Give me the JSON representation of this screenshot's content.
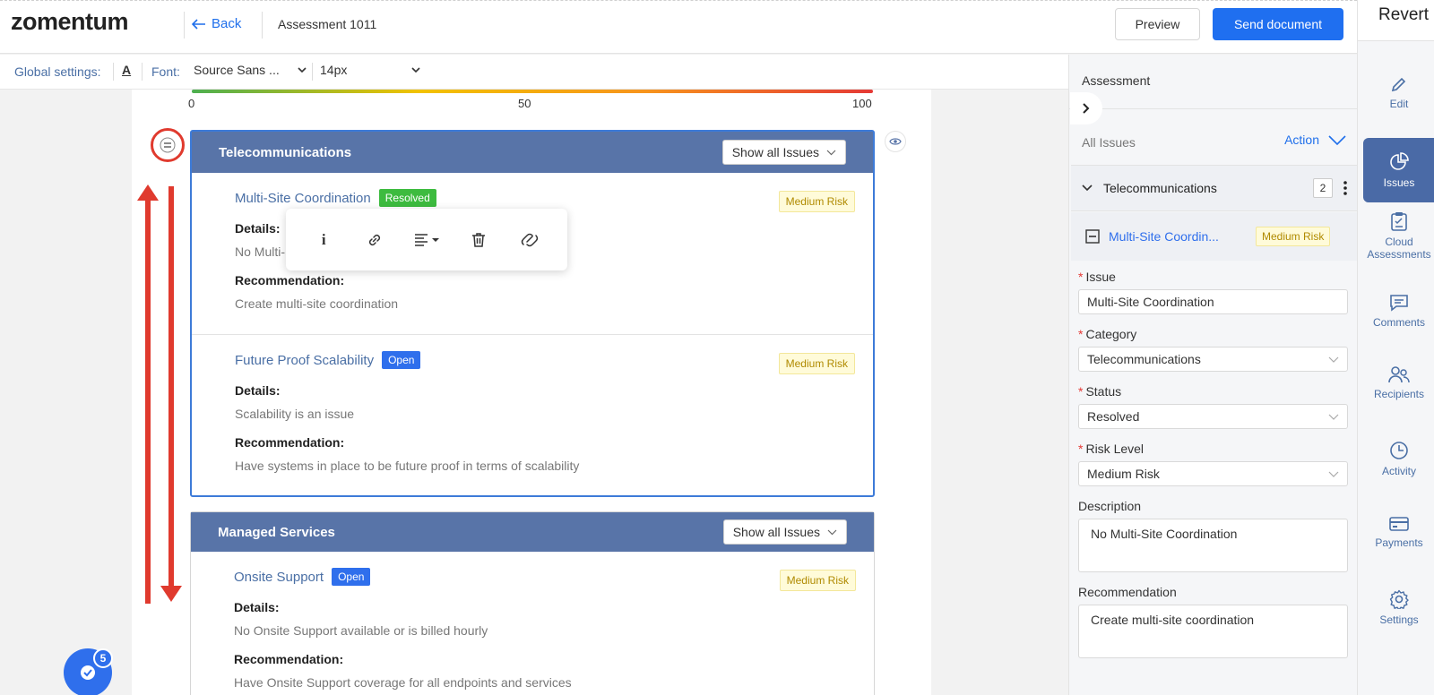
{
  "header": {
    "logo": "zomentum",
    "back_label": "Back",
    "doc_title": "Assessment 1011",
    "preview_label": "Preview",
    "send_label": "Send document",
    "revert_label": "Revert"
  },
  "global_settings": {
    "label": "Global settings:",
    "font_color_glyph": "A",
    "font_label": "Font:",
    "font_value": "Source Sans ...",
    "size_value": "14px"
  },
  "score_scale": {
    "ticks": [
      "0",
      "50",
      "100"
    ]
  },
  "sections": [
    {
      "title": "Telecommunications",
      "show_label": "Show all Issues",
      "issues": [
        {
          "title": "Multi-Site Coordination",
          "status": "Resolved",
          "risk": "Medium Risk",
          "details_label": "Details:",
          "details": "No Multi-",
          "rec_label": "Recommendation:",
          "recommendation": "Create multi-site coordination"
        },
        {
          "title": "Future Proof Scalability",
          "status": "Open",
          "risk": "Medium Risk",
          "details_label": "Details:",
          "details": "Scalability is an issue",
          "rec_label": "Recommendation:",
          "recommendation": "Have systems in place to be future proof in terms of scalability"
        }
      ]
    },
    {
      "title": "Managed Services",
      "show_label": "Show all Issues",
      "issues": [
        {
          "title": "Onsite Support",
          "status": "Open",
          "risk": "Medium Risk",
          "details_label": "Details:",
          "details": "No Onsite Support available or is billed hourly",
          "rec_label": "Recommendation:",
          "recommendation": "Have Onsite Support coverage for all endpoints and services"
        }
      ]
    }
  ],
  "floating_toolbar": {
    "info_glyph": "i"
  },
  "fab": {
    "count": "5"
  },
  "right_panel": {
    "title": "Assessment",
    "all_issues": "All Issues",
    "action_label": "Action",
    "category_name": "Telecommunications",
    "category_count": "2",
    "selected_issue": "Multi-Site Coordin...",
    "selected_issue_risk": "Medium Risk",
    "form": {
      "issue_label": "Issue",
      "issue_value": "Multi-Site Coordination",
      "category_label": "Category",
      "category_value": "Telecommunications",
      "status_label": "Status",
      "status_value": "Resolved",
      "risk_label": "Risk Level",
      "risk_value": "Medium Risk",
      "description_label": "Description",
      "description_value": "No Multi-Site Coordination",
      "recommendation_label": "Recommendation",
      "recommendation_value": "Create multi-site coordination",
      "required_marker": "*"
    }
  },
  "nav_rail": {
    "items": [
      {
        "label": "Edit",
        "icon": "pencil-icon"
      },
      {
        "label": "Issues",
        "icon": "pie-chart-icon"
      },
      {
        "label": "Cloud Assessments",
        "icon": "clipboard-icon"
      },
      {
        "label": "Comments",
        "icon": "comment-icon"
      },
      {
        "label": "Recipients",
        "icon": "users-icon"
      },
      {
        "label": "Activity",
        "icon": "clock-icon"
      },
      {
        "label": "Payments",
        "icon": "card-icon"
      },
      {
        "label": "Settings",
        "icon": "gear-icon"
      }
    ]
  },
  "colors": {
    "primary": "#1f6ff0",
    "section_header": "#5874a8",
    "resolved": "#3dbb3f",
    "open": "#2f6fec",
    "annotation": "#e03a2e",
    "nav_active": "#4a6aa6"
  }
}
